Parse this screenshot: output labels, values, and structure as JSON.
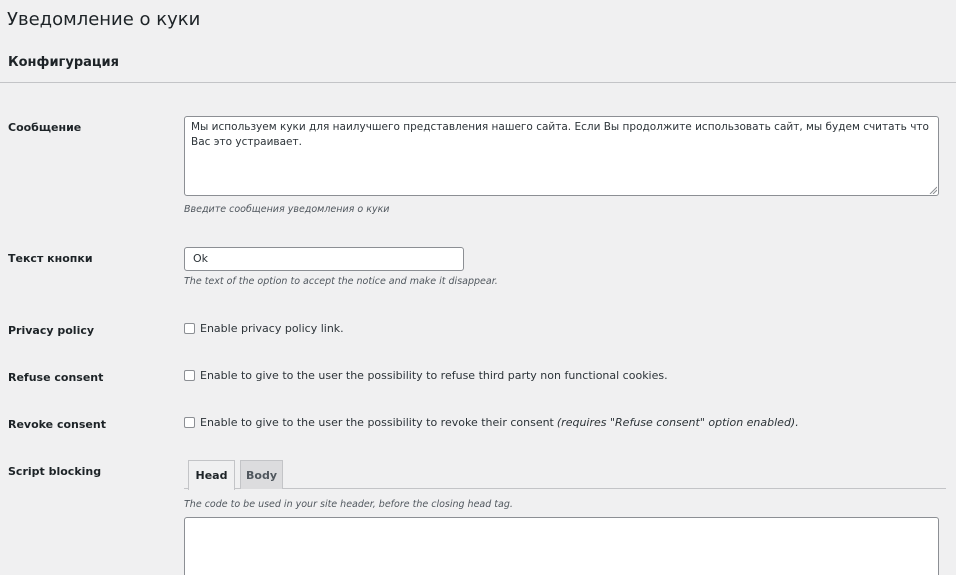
{
  "page": {
    "title": "Уведомление о куки",
    "section": "Конфигурация"
  },
  "message": {
    "label": "Сообщение",
    "value": "Мы используем куки для наилучшего представления нашего сайта. Если Вы продолжите использовать сайт, мы будем считать что Вас это устраивает.",
    "description": "Введите сообщения уведомления о куки"
  },
  "button_text": {
    "label": "Текст кнопки",
    "value": "Ok",
    "description": "The text of the option to accept the notice and make it disappear."
  },
  "privacy_policy": {
    "label": "Privacy policy",
    "checkbox_label": "Enable privacy policy link.",
    "checked": false
  },
  "refuse_consent": {
    "label": "Refuse consent",
    "checkbox_label": "Enable to give to the user the possibility to refuse third party non functional cookies.",
    "checked": false
  },
  "revoke_consent": {
    "label": "Revoke consent",
    "checkbox_label": "Enable to give to the user the possibility to revoke their consent",
    "note": "(requires \"Refuse consent\" option enabled).",
    "checked": false
  },
  "script_blocking": {
    "label": "Script blocking",
    "tabs": [
      {
        "label": "Head",
        "active": true
      },
      {
        "label": "Body",
        "active": false
      }
    ],
    "description": "The code to be used in your site header, before the closing head tag.",
    "code_value": ""
  }
}
